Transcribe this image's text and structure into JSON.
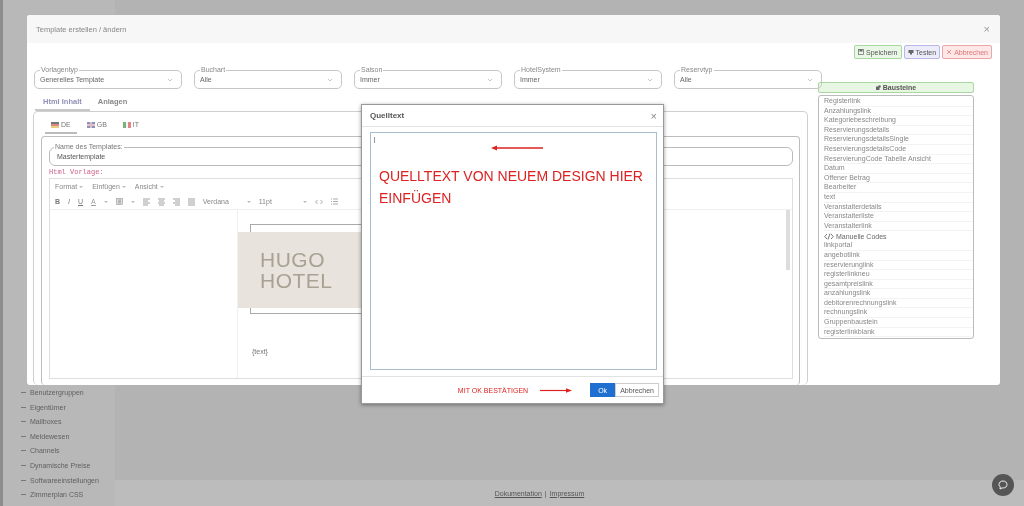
{
  "background": {
    "sidebar_items": [
      "Benutzergruppen",
      "Eigentümer",
      "Mailboxes",
      "Meldewesen",
      "Channels",
      "Dynamische Preise",
      "Softwareeinstellungen",
      "Zimmerplan CSS"
    ],
    "footer_links": [
      "Dokumentation",
      "Impressum"
    ],
    "footer_separator": "|"
  },
  "modal": {
    "title": "Template erstellen / ändern",
    "actions": [
      {
        "label": "Speichern",
        "kind": "save"
      },
      {
        "label": "Testen",
        "kind": "test"
      },
      {
        "label": "Abbrechen",
        "kind": "cancel"
      }
    ],
    "selects": [
      {
        "label": "Vorlagentyp",
        "value": "Generelles Template"
      },
      {
        "label": "Buchart",
        "value": "Alle"
      },
      {
        "label": "Saison",
        "value": "Immer"
      },
      {
        "label": "HotelSystem",
        "value": "Immer"
      },
      {
        "label": "Reservtyp",
        "value": "Alle"
      }
    ],
    "tabs": [
      {
        "label": "Html Inhalt",
        "selected": true
      },
      {
        "label": "Anlagen",
        "selected": false
      }
    ],
    "close_label": "×",
    "languages": [
      {
        "label": "DE",
        "kind": "de",
        "selected": true
      },
      {
        "label": "GB",
        "kind": "gb",
        "selected": false
      },
      {
        "label": "IT",
        "kind": "it",
        "selected": false
      }
    ],
    "name_field": {
      "label": "Name des Templates:",
      "value": "Mastertemplate"
    },
    "html_label": "Html Vorlage:",
    "editor": {
      "menus": [
        "Format",
        "Einfügen",
        "Ansicht"
      ],
      "letters": [
        "B",
        "I",
        "U",
        "A"
      ],
      "font": "Verdana",
      "size": "11pt",
      "content": {
        "logo_lines": [
          "HUGO",
          "HOTEL"
        ],
        "text": "{text}"
      }
    },
    "bausteine": {
      "title": "Bausteine",
      "items": [
        {
          "label": "Registerlink",
          "kind": "item"
        },
        {
          "label": "Anzahlungslink",
          "kind": "item"
        },
        {
          "label": "Kategoriebeschreibung",
          "kind": "item"
        },
        {
          "label": "Reservierungsdetails",
          "kind": "item"
        },
        {
          "label": "ReservierungsdetailsSingle",
          "kind": "item"
        },
        {
          "label": "ReservierungsdetailsCode",
          "kind": "item"
        },
        {
          "label": "ReservierungCode Tabelle Ansicht",
          "kind": "item"
        },
        {
          "label": "Datum",
          "kind": "item"
        },
        {
          "label": "Offener Betrag",
          "kind": "item"
        },
        {
          "label": "Bearbeiter",
          "kind": "item"
        },
        {
          "label": "text",
          "kind": "item"
        },
        {
          "label": "Veranstalterdetails",
          "kind": "item"
        },
        {
          "label": "Veranstalterliste",
          "kind": "item"
        },
        {
          "label": "Veranstalterlink",
          "kind": "item"
        },
        {
          "label": "Manuelle Codes",
          "kind": "header"
        },
        {
          "label": "linkportal",
          "kind": "item"
        },
        {
          "label": "angebotlink",
          "kind": "item"
        },
        {
          "label": "reservierunglink",
          "kind": "item"
        },
        {
          "label": "registerlinkneu",
          "kind": "item"
        },
        {
          "label": "gesamtpreislink",
          "kind": "item"
        },
        {
          "label": "anzahlungslink",
          "kind": "item"
        },
        {
          "label": "debitorenrechnungslink",
          "kind": "item"
        },
        {
          "label": "rechnungslink",
          "kind": "item"
        },
        {
          "label": "Gruppenbaustein",
          "kind": "item"
        },
        {
          "label": "registerlinkblank",
          "kind": "item"
        }
      ]
    }
  },
  "source_dialog": {
    "title": "Quelltext",
    "close_label": "×",
    "annotation": "QUELLTEXT VON NEUEM DESIGN HIER EINFÜGEN",
    "footer_note": "MIT OK BESTÄTIGEN",
    "buttons": [
      {
        "label": "Ok",
        "kind": "primary"
      },
      {
        "label": "Abbrechen",
        "kind": "default"
      }
    ]
  }
}
